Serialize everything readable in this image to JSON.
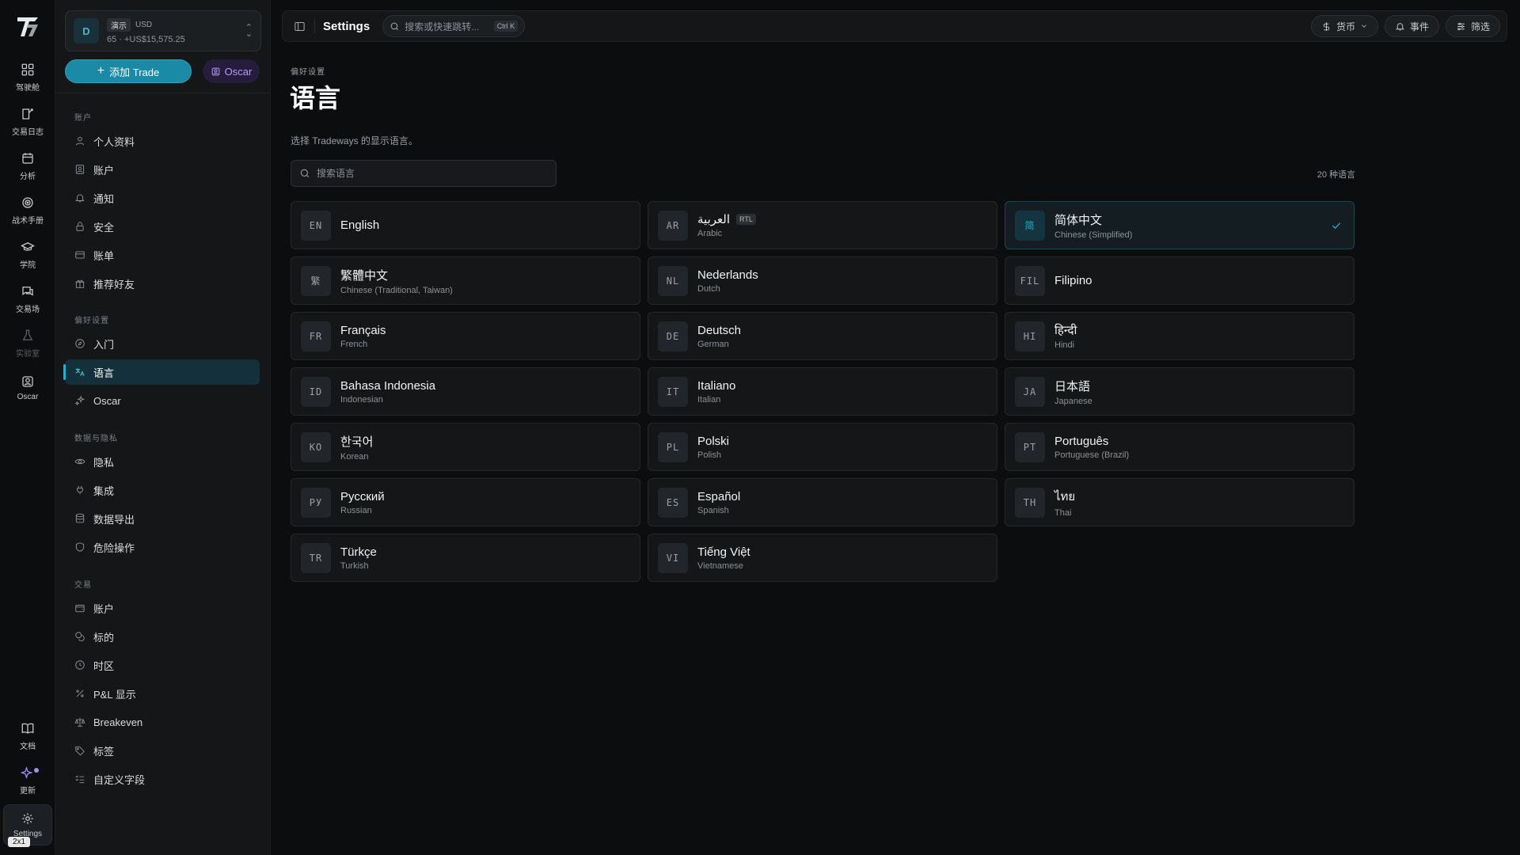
{
  "rail": {
    "items": [
      {
        "label": "驾驶舱",
        "icon": "dashboard-icon"
      },
      {
        "label": "交易日志",
        "icon": "journal-icon"
      },
      {
        "label": "分析",
        "icon": "calendar-icon"
      },
      {
        "label": "战术手册",
        "icon": "target-icon"
      },
      {
        "label": "学院",
        "icon": "graduation-cap-icon"
      },
      {
        "label": "交易场",
        "icon": "chat-icon"
      },
      {
        "label": "实验室",
        "icon": "flask-icon"
      },
      {
        "label": "Oscar",
        "icon": "oscar-icon"
      }
    ],
    "bottom": [
      {
        "label": "文档",
        "icon": "book-icon"
      },
      {
        "label": "更新",
        "icon": "sparkle-icon"
      },
      {
        "label": "Settings",
        "icon": "gear-icon"
      }
    ],
    "size_tag": "2x1"
  },
  "account": {
    "avatar": "D",
    "badge": "演示",
    "currency": "USD",
    "summary": "65 · +US$15,575.25"
  },
  "actions": {
    "add_trade": "添加 Trade",
    "oscar": "Oscar"
  },
  "sidebar": {
    "sections": [
      {
        "title": "账户",
        "items": [
          {
            "label": "个人资料",
            "icon": "user-icon"
          },
          {
            "label": "账户",
            "icon": "id-card-icon"
          },
          {
            "label": "通知",
            "icon": "bell-icon"
          },
          {
            "label": "安全",
            "icon": "lock-icon"
          },
          {
            "label": "账单",
            "icon": "credit-card-icon"
          },
          {
            "label": "推荐好友",
            "icon": "gift-icon"
          }
        ]
      },
      {
        "title": "偏好设置",
        "items": [
          {
            "label": "入门",
            "icon": "compass-icon"
          },
          {
            "label": "语言",
            "icon": "translate-icon"
          },
          {
            "label": "Oscar",
            "icon": "sparkles-icon"
          }
        ]
      },
      {
        "title": "数据与隐私",
        "items": [
          {
            "label": "隐私",
            "icon": "eye-icon"
          },
          {
            "label": "集成",
            "icon": "plug-icon"
          },
          {
            "label": "数据导出",
            "icon": "database-icon"
          },
          {
            "label": "危险操作",
            "icon": "shield-icon"
          }
        ]
      },
      {
        "title": "交易",
        "items": [
          {
            "label": "账户",
            "icon": "wallet-icon"
          },
          {
            "label": "标的",
            "icon": "coins-icon"
          },
          {
            "label": "时区",
            "icon": "clock-icon"
          },
          {
            "label": "P&L 显示",
            "icon": "percent-icon"
          },
          {
            "label": "Breakeven",
            "icon": "scale-icon"
          },
          {
            "label": "标签",
            "icon": "tag-icon"
          },
          {
            "label": "自定义字段",
            "icon": "list-checks-icon"
          }
        ]
      }
    ]
  },
  "topbar": {
    "title": "Settings",
    "search_placeholder": "搜索或快速跳转...",
    "shortcut": "Ctrl K",
    "currency": "货币",
    "events": "事件",
    "filter": "筛选"
  },
  "page": {
    "eyebrow": "偏好设置",
    "title": "语言",
    "description": "选择 Tradeways 的显示语言。",
    "search_placeholder": "搜索语言",
    "count": "20 种语言"
  },
  "languages": [
    {
      "code": "EN",
      "native": "English",
      "english": ""
    },
    {
      "code": "AR",
      "native": "العربية",
      "english": "Arabic",
      "badge": "RTL"
    },
    {
      "code": "简",
      "native": "简体中文",
      "english": "Chinese (Simplified)",
      "selected": true
    },
    {
      "code": "繁",
      "native": "繁體中文",
      "english": "Chinese (Traditional, Taiwan)"
    },
    {
      "code": "NL",
      "native": "Nederlands",
      "english": "Dutch"
    },
    {
      "code": "FIL",
      "native": "Filipino",
      "english": ""
    },
    {
      "code": "FR",
      "native": "Français",
      "english": "French"
    },
    {
      "code": "DE",
      "native": "Deutsch",
      "english": "German"
    },
    {
      "code": "HI",
      "native": "हिन्दी",
      "english": "Hindi"
    },
    {
      "code": "ID",
      "native": "Bahasa Indonesia",
      "english": "Indonesian"
    },
    {
      "code": "IT",
      "native": "Italiano",
      "english": "Italian"
    },
    {
      "code": "JA",
      "native": "日本語",
      "english": "Japanese"
    },
    {
      "code": "KO",
      "native": "한국어",
      "english": "Korean"
    },
    {
      "code": "PL",
      "native": "Polski",
      "english": "Polish"
    },
    {
      "code": "PT",
      "native": "Português",
      "english": "Portuguese (Brazil)"
    },
    {
      "code": "РУ",
      "native": "Русский",
      "english": "Russian"
    },
    {
      "code": "ES",
      "native": "Español",
      "english": "Spanish"
    },
    {
      "code": "TH",
      "native": "ไทย",
      "english": "Thai"
    },
    {
      "code": "TR",
      "native": "Türkçe",
      "english": "Turkish"
    },
    {
      "code": "VI",
      "native": "Tiếng Việt",
      "english": "Vietnamese"
    }
  ],
  "colors": {
    "accent": "#1a8aa6",
    "oscar": "#b79cf7",
    "background": "#0c0d0f"
  }
}
